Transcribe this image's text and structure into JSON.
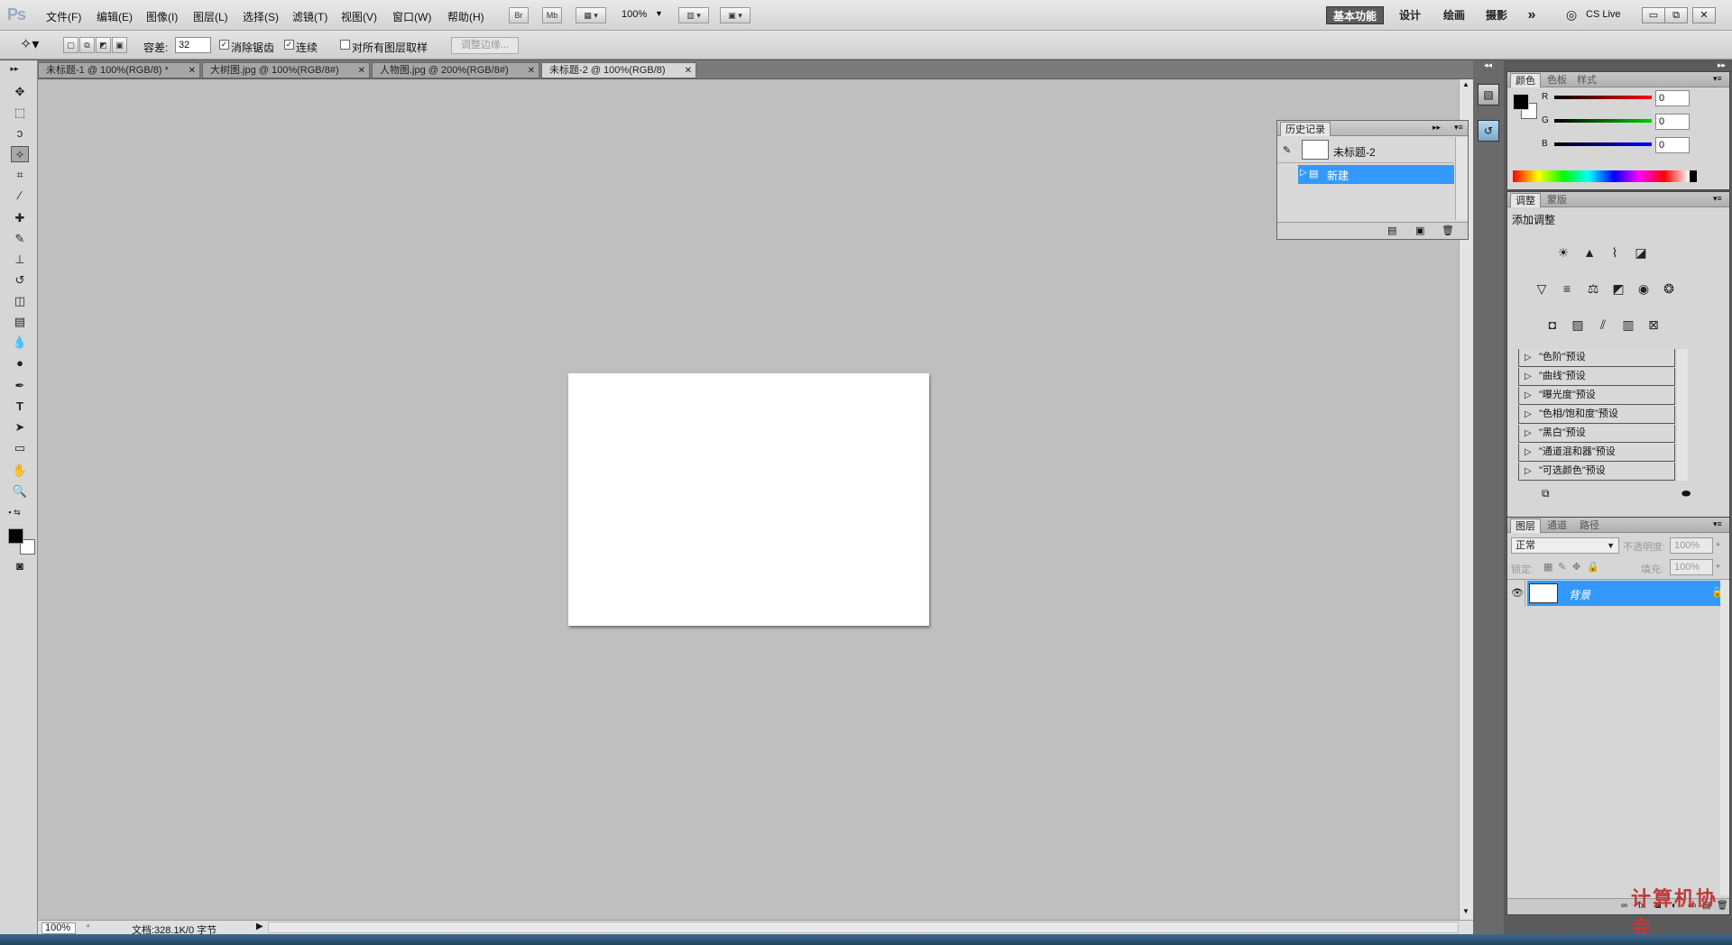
{
  "app": {
    "logo": "Ps"
  },
  "menu": {
    "items": [
      "文件(F)",
      "编辑(E)",
      "图像(I)",
      "图层(L)",
      "选择(S)",
      "滤镜(T)",
      "视图(V)",
      "窗口(W)",
      "帮助(H)"
    ]
  },
  "menubar_buttons": {
    "br": "Br",
    "mb": "Mb",
    "zoom": "100%"
  },
  "workspaces": {
    "basic": "基本功能",
    "design": "设计",
    "paint": "绘画",
    "photo": "摄影",
    "more": "»",
    "cslive": "CS Live"
  },
  "window_controls": {
    "minimize": "▭",
    "restore": "⧉",
    "close": "✕"
  },
  "options": {
    "tolerance_label": "容差:",
    "tolerance_value": "32",
    "antialias_label": "消除锯齿",
    "antialias_checked": true,
    "contiguous_label": "连续",
    "contiguous_checked": true,
    "sample_all_label": "对所有图层取样",
    "sample_all_checked": false,
    "refine_edge": "调整边缘..."
  },
  "tabs": [
    {
      "label": "未标题-1 @ 100%(RGB/8) *",
      "active": false
    },
    {
      "label": "大树图.jpg @ 100%(RGB/8#)",
      "active": false
    },
    {
      "label": "人物图.jpg @ 200%(RGB/8#)",
      "active": false
    },
    {
      "label": "未标题-2 @ 100%(RGB/8)",
      "active": true
    }
  ],
  "history": {
    "tab": "历史记录",
    "snapshot": "未标题-2",
    "items": [
      "新建"
    ]
  },
  "color_panel": {
    "tabs": [
      "颜色",
      "色板",
      "样式"
    ],
    "r": {
      "label": "R",
      "value": "0"
    },
    "g": {
      "label": "G",
      "value": "0"
    },
    "b": {
      "label": "B",
      "value": "0"
    },
    "fg_color": "#000000",
    "bg_color": "#ffffff"
  },
  "adjust_panel": {
    "tabs": [
      "调整",
      "蒙版"
    ],
    "title": "添加调整",
    "presets": [
      "\"色阶\"预设",
      "\"曲线\"预设",
      "\"曝光度\"预设",
      "\"色相/饱和度\"预设",
      "\"黑白\"预设",
      "\"通道混和器\"预设",
      "\"可选颜色\"预设"
    ]
  },
  "layers_panel": {
    "tabs": [
      "图层",
      "通道",
      "路径"
    ],
    "blend_mode": "正常",
    "opacity_label": "不透明度:",
    "opacity_value": "100%",
    "lock_label": "锁定:",
    "fill_label": "填充:",
    "fill_value": "100%",
    "layers": [
      {
        "name": "背景",
        "selected": true
      }
    ]
  },
  "status": {
    "zoom": "100%",
    "doc_info": "文档:328.1K/0 字节"
  },
  "watermark": {
    "text": "计算机协会"
  },
  "colors": {
    "accent": "#3399ff",
    "canvas_bg": "#bfbfbf"
  }
}
